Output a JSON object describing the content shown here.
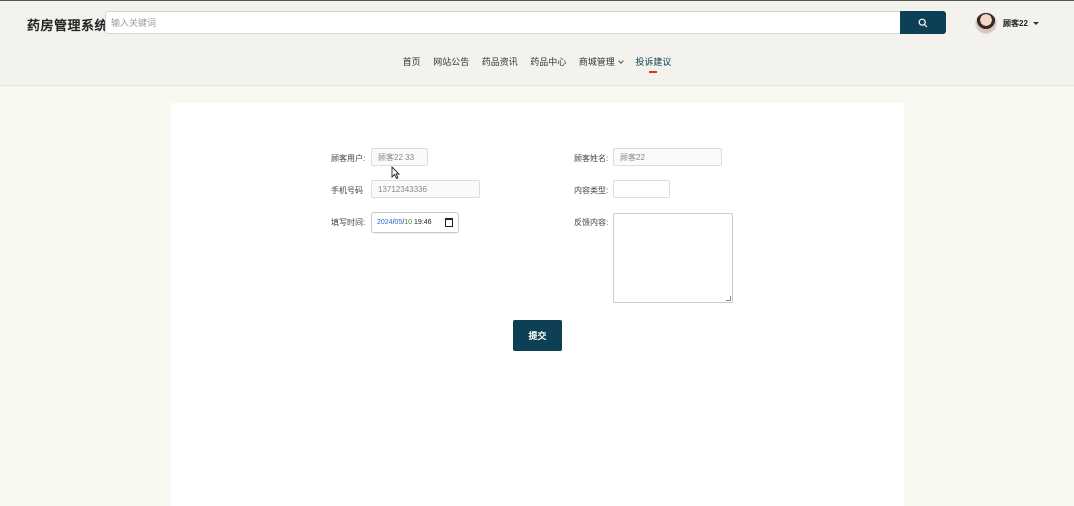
{
  "header": {
    "logo": "药房管理系统",
    "search": {
      "placeholder": "输入关键词",
      "value": ""
    },
    "search_button_icon": "search-icon",
    "user": {
      "name": "顾客22",
      "avatar_icon": "user-avatar"
    }
  },
  "nav": {
    "items": [
      {
        "label": "首页"
      },
      {
        "label": "网站公告"
      },
      {
        "label": "药品资讯"
      },
      {
        "label": "药品中心"
      },
      {
        "label": "商城管理"
      },
      {
        "label": "投诉建议"
      }
    ],
    "active": "投诉建议"
  },
  "form": {
    "customer_user": {
      "label": "顾客用户:",
      "value": "顾客22 33"
    },
    "customer_name": {
      "label": "顾客姓名:",
      "value": "顾客22"
    },
    "phone": {
      "label": "手机号码",
      "value": "13712343336"
    },
    "content_type": {
      "label": "内容类型:",
      "value": ""
    },
    "fill_time": {
      "label": "填写时间:",
      "year": "2024",
      "month": "05",
      "day": "10",
      "sep": "/",
      "time": "19:46"
    },
    "feedback": {
      "label": "反馈内容:",
      "value": ""
    },
    "submit_label": "提交"
  },
  "colors": {
    "primary": "#0d4055",
    "accent": "#e0341a",
    "page_bg": "#f7f8ef",
    "header_bg": "#f3f2ec"
  }
}
